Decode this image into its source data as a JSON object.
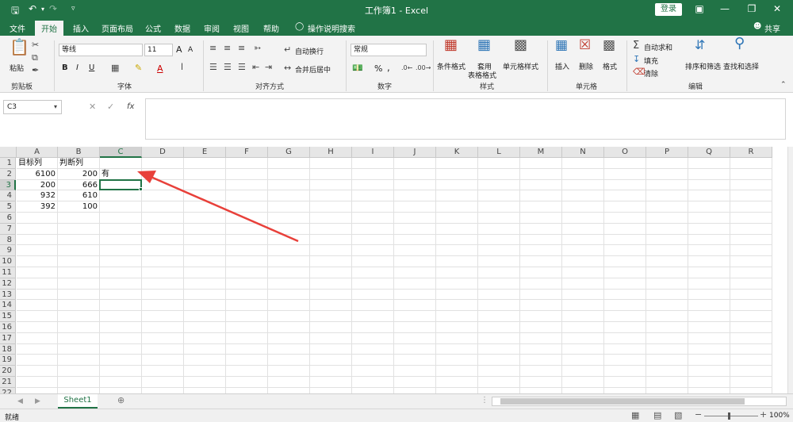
{
  "titlebar": {
    "title": "工作簿1 - Excel",
    "login": "登录",
    "save_icon": "save-icon",
    "undo_icon": "undo-icon",
    "redo_icon": "redo-icon"
  },
  "tabs": [
    "文件",
    "开始",
    "插入",
    "页面布局",
    "公式",
    "数据",
    "审阅",
    "视图",
    "帮助",
    "操作说明搜索"
  ],
  "share": "共享",
  "ribbon": {
    "clipboard": {
      "paste": "粘贴",
      "label": "剪贴板"
    },
    "font": {
      "name": "等线",
      "size": "11",
      "label": "字体",
      "bold": "B",
      "italic": "I",
      "underline": "U",
      "grow": "A",
      "shrink": "A",
      "font_color": "A"
    },
    "alignment": {
      "wrap": "自动换行",
      "merge": "合并后居中",
      "label": "对齐方式"
    },
    "number": {
      "format": "常规",
      "percent": "%",
      "comma": ",",
      "label": "数字"
    },
    "styles": {
      "conditional": "条件格式",
      "table_l1": "套用",
      "table_l2": "表格格式",
      "cell_styles": "单元格样式",
      "label": "样式"
    },
    "cells": {
      "insert": "插入",
      "delete": "删除",
      "format": "格式",
      "label": "单元格"
    },
    "editing": {
      "autosum": "自动求和",
      "fill": "填充",
      "clear": "清除",
      "sort": "排序和筛选",
      "find": "查找和选择",
      "label": "编辑"
    }
  },
  "formula_bar": {
    "name_box": "C3",
    "fx": "fx",
    "content": ""
  },
  "columns": [
    "A",
    "B",
    "C",
    "D",
    "E",
    "F",
    "G",
    "H",
    "I",
    "J",
    "K",
    "L",
    "M",
    "N",
    "O",
    "P",
    "Q",
    "R"
  ],
  "rows": [
    "1",
    "2",
    "3",
    "4",
    "5",
    "6",
    "7",
    "8",
    "9",
    "10",
    "11",
    "12",
    "13",
    "14",
    "15",
    "16",
    "17",
    "18",
    "19",
    "20",
    "21",
    "22"
  ],
  "cells": {
    "A1": "目标列",
    "B1": "判断列",
    "A2": "6100",
    "B2": "200",
    "C2": "有",
    "A3": "200",
    "B3": "666",
    "A4": "932",
    "B4": "610",
    "A5": "392",
    "B5": "100"
  },
  "active_cell": "C3",
  "sheet": {
    "name": "Sheet1"
  },
  "status": {
    "ready": "就绪",
    "zoom": "100%"
  },
  "colors": {
    "accent": "#217346",
    "arrow": "#e8403a"
  }
}
